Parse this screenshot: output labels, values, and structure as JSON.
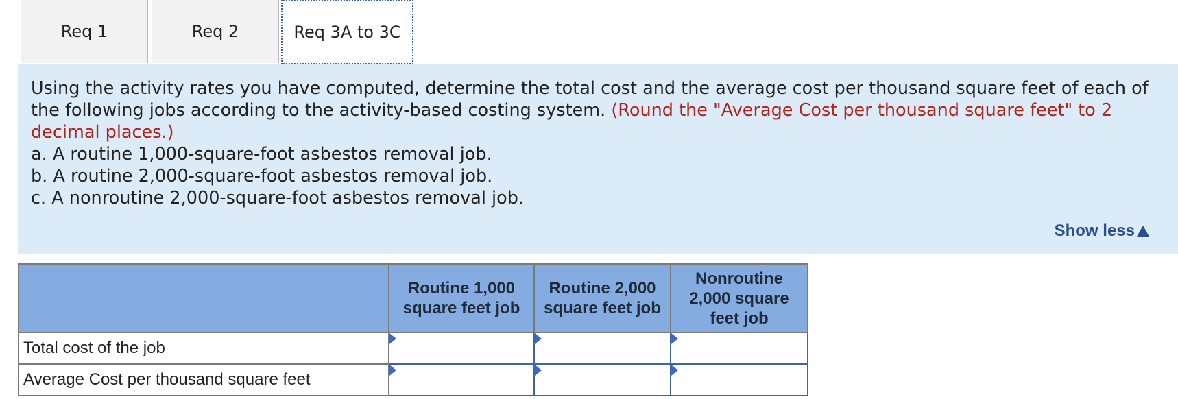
{
  "tabs": [
    {
      "label": "Req 1"
    },
    {
      "label": "Req 2"
    },
    {
      "label": "Req 3A to 3C"
    }
  ],
  "instructions": {
    "text": "Using the activity rates you have computed, determine the total cost and the average cost per thousand square feet of each of the following jobs according to the activity-based costing system. ",
    "note": "(Round the \"Average Cost per thousand square feet\" to 2 decimal places.)",
    "items": [
      "a. A routine 1,000-square-foot asbestos removal job.",
      "b. A routine 2,000-square-foot asbestos removal job.",
      "c. A nonroutine 2,000-square-foot asbestos removal job."
    ],
    "show_less": "Show less"
  },
  "table": {
    "columns": [
      "Routine 1,000 square feet job",
      "Routine 2,000 square feet job",
      "Nonroutine 2,000 square feet job"
    ],
    "rows": [
      {
        "label": "Total cost of the job",
        "values": [
          "",
          "",
          ""
        ]
      },
      {
        "label": "Average Cost per thousand square feet",
        "values": [
          "",
          "",
          ""
        ]
      }
    ]
  }
}
